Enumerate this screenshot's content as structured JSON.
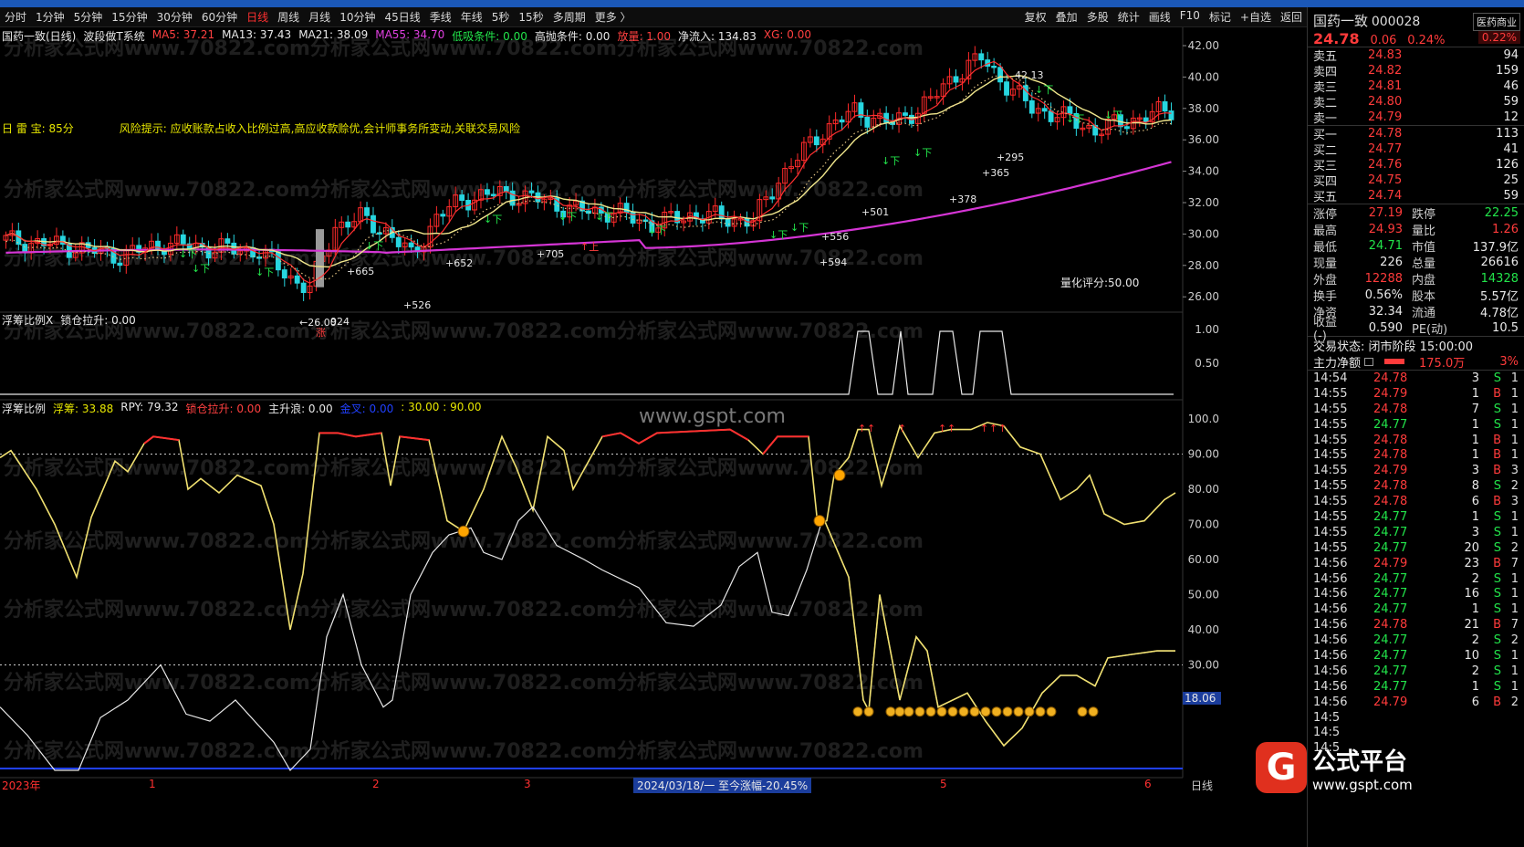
{
  "menu": {
    "periods": [
      "分时",
      "1分钟",
      "5分钟",
      "15分钟",
      "30分钟",
      "60分钟",
      "日线",
      "周线",
      "月线",
      "10分钟",
      "45日线",
      "季线",
      "年线",
      "5秒",
      "15秒",
      "多周期",
      "更多 〉"
    ],
    "active": "日线",
    "tools": [
      "复权",
      "叠加",
      "多股",
      "统计",
      "画线",
      "F10",
      "标记",
      "+自选",
      "返回"
    ]
  },
  "main_panel": {
    "title": "国药一致(日线)",
    "system": "波段做T系统",
    "indicators": [
      {
        "label": "MA5: 37.21",
        "color": "#ff4040"
      },
      {
        "label": "MA13: 37.43",
        "color": "#e8e8e8"
      },
      {
        "label": "MA21: 38.09",
        "color": "#e8e8e8"
      },
      {
        "label": "MA55: 34.70",
        "color": "#e040e0"
      },
      {
        "label": "低吸条件: 0.00",
        "color": "#22e34a"
      },
      {
        "label": "高抛条件: 0.00",
        "color": "#e8e8e8"
      },
      {
        "label": "放量: 1.00",
        "color": "#ff4040"
      },
      {
        "label": "净流入: 134.83",
        "color": "#e8e8e8"
      },
      {
        "label": "XG: 0.00",
        "color": "#ff4040"
      }
    ],
    "risk_label": "日 雷 宝:   85分",
    "risk_text": "风险提示:   应收账款占收入比例过高,高应收款赊优,会计师事务所变动,关联交易风险",
    "score_label": "量化评分:50.00",
    "y_axis": [
      "42.00",
      "40.00",
      "38.00",
      "36.00",
      "34.00",
      "32.00",
      "30.00",
      "28.00",
      "26.00"
    ],
    "annotations": [
      {
        "text": "42.13",
        "color": "#e8e8e8"
      },
      {
        "text": "+526",
        "color": "#e8e8e8"
      },
      {
        "text": "+665",
        "color": "#e8e8e8"
      },
      {
        "text": "+652",
        "color": "#e8e8e8"
      },
      {
        "text": "+705",
        "color": "#e8e8e8"
      },
      {
        "text": "+594",
        "color": "#e8e8e8"
      },
      {
        "text": "+556",
        "color": "#e8e8e8"
      },
      {
        "text": "+501",
        "color": "#e8e8e8"
      },
      {
        "text": "+378",
        "color": "#e8e8e8"
      },
      {
        "text": "+365",
        "color": "#e8e8e8"
      },
      {
        "text": "+295",
        "color": "#e8e8e8"
      },
      {
        "text": "↓下",
        "color": "#22e34a"
      },
      {
        "text": "↑上",
        "color": "#ff4040"
      },
      {
        "text": "←26.00",
        "color": "#e8e8e8"
      },
      {
        "text": "924",
        "color": "#e8e8e8"
      },
      {
        "text": "涨",
        "color": "#ff4040"
      }
    ]
  },
  "panel2": {
    "title": "浮筹比例X",
    "label": "锁仓拉升: 0.00",
    "y_axis": [
      "1.00",
      "0.50"
    ]
  },
  "panel3": {
    "title": "浮筹比例",
    "items": [
      {
        "label": "浮筹: 33.88",
        "color": "#e6e600"
      },
      {
        "label": "RPY: 79.32",
        "color": "#e8e8e8"
      },
      {
        "label": "锁仓拉升: 0.00",
        "color": "#ff4040"
      },
      {
        "label": "主升浪: 0.00",
        "color": "#e8e8e8"
      },
      {
        "label": "金叉: 0.00",
        "color": "#2040ff"
      },
      {
        "label": ": 30.00 : 90.00",
        "color": "#e6e600"
      }
    ],
    "y_axis": [
      "100.0",
      "90.00",
      "80.00",
      "70.00",
      "60.00",
      "50.00",
      "40.00",
      "30.00"
    ],
    "current_value": "18.06"
  },
  "bottom_axis": {
    "labels": [
      "2023年",
      "1",
      "2",
      "3",
      "5",
      "6"
    ],
    "hover_info": "2024/03/18/一  至今涨幅-20.45%",
    "period": "日线"
  },
  "watermark_text": "分析家公式网www.70822.com",
  "site_watermark": "www.gspt.com",
  "brand": {
    "name": "公式平台",
    "url": "www.gspt.com"
  },
  "quote": {
    "name": "国药一致",
    "code": "000028",
    "tag": "医药商业",
    "price": "24.78",
    "change": "0.06",
    "change_pct": "0.24%",
    "badge_pct": "0.22%",
    "asks": [
      {
        "label": "卖五",
        "price": "24.83",
        "vol": "94"
      },
      {
        "label": "卖四",
        "price": "24.82",
        "vol": "159"
      },
      {
        "label": "卖三",
        "price": "24.81",
        "vol": "46"
      },
      {
        "label": "卖二",
        "price": "24.80",
        "vol": "59"
      },
      {
        "label": "卖一",
        "price": "24.79",
        "vol": "12"
      }
    ],
    "bids": [
      {
        "label": "买一",
        "price": "24.78",
        "vol": "113"
      },
      {
        "label": "买二",
        "price": "24.77",
        "vol": "41"
      },
      {
        "label": "买三",
        "price": "24.76",
        "vol": "126"
      },
      {
        "label": "买四",
        "price": "24.75",
        "vol": "25"
      },
      {
        "label": "买五",
        "price": "24.74",
        "vol": "59"
      }
    ],
    "stats": [
      {
        "l1": "涨停",
        "v1": "27.19",
        "c1": "red",
        "l2": "跌停",
        "v2": "22.25",
        "c2": "green"
      },
      {
        "l1": "最高",
        "v1": "24.93",
        "c1": "red",
        "l2": "量比",
        "v2": "1.26",
        "c2": "red"
      },
      {
        "l1": "最低",
        "v1": "24.71",
        "c1": "green",
        "l2": "市值",
        "v2": "137.9亿",
        "c2": "white"
      },
      {
        "l1": "现量",
        "v1": "226",
        "c1": "white",
        "l2": "总量",
        "v2": "26616",
        "c2": "white"
      },
      {
        "l1": "外盘",
        "v1": "12288",
        "c1": "red",
        "l2": "内盘",
        "v2": "14328",
        "c2": "green"
      },
      {
        "l1": "换手",
        "v1": "0.56%",
        "c1": "white",
        "l2": "股本",
        "v2": "5.57亿",
        "c2": "white"
      },
      {
        "l1": "净资",
        "v1": "32.34",
        "c1": "white",
        "l2": "流通",
        "v2": "4.78亿",
        "c2": "white"
      },
      {
        "l1": "收益(-)",
        "v1": "0.590",
        "c1": "white",
        "l2": "PE(动)",
        "v2": "10.5",
        "c2": "white"
      }
    ],
    "trade_status": "交易状态: 闭市阶段 15:00:00",
    "main_flow_label": "主力净额",
    "main_flow_value": "175.0万",
    "main_flow_pct": "3%",
    "ticks": [
      [
        "14:54",
        "24.78",
        "3",
        "S",
        "1"
      ],
      [
        "14:55",
        "24.79",
        "1",
        "B",
        "1"
      ],
      [
        "14:55",
        "24.78",
        "7",
        "S",
        "1"
      ],
      [
        "14:55",
        "24.77",
        "1",
        "S",
        "1"
      ],
      [
        "14:55",
        "24.78",
        "1",
        "B",
        "1"
      ],
      [
        "14:55",
        "24.78",
        "1",
        "B",
        "1"
      ],
      [
        "14:55",
        "24.79",
        "3",
        "B",
        "3"
      ],
      [
        "14:55",
        "24.78",
        "8",
        "S",
        "2"
      ],
      [
        "14:55",
        "24.78",
        "6",
        "B",
        "3"
      ],
      [
        "14:55",
        "24.77",
        "1",
        "S",
        "1"
      ],
      [
        "14:55",
        "24.77",
        "3",
        "S",
        "1"
      ],
      [
        "14:55",
        "24.77",
        "20",
        "S",
        "2"
      ],
      [
        "14:56",
        "24.79",
        "23",
        "B",
        "7"
      ],
      [
        "14:56",
        "24.77",
        "2",
        "S",
        "1"
      ],
      [
        "14:56",
        "24.77",
        "16",
        "S",
        "1"
      ],
      [
        "14:56",
        "24.77",
        "1",
        "S",
        "1"
      ],
      [
        "14:56",
        "24.78",
        "21",
        "B",
        "7"
      ],
      [
        "14:56",
        "24.77",
        "2",
        "S",
        "2"
      ],
      [
        "14:56",
        "24.77",
        "10",
        "S",
        "1"
      ],
      [
        "14:56",
        "24.77",
        "2",
        "S",
        "1"
      ],
      [
        "14:56",
        "24.77",
        "1",
        "S",
        "1"
      ],
      [
        "14:56",
        "24.79",
        "6",
        "B",
        "2"
      ],
      [
        "14:5",
        "",
        "",
        "",
        ""
      ],
      [
        "14:5",
        "",
        "",
        "",
        ""
      ],
      [
        "14:5",
        "",
        "",
        "",
        ""
      ]
    ]
  }
}
